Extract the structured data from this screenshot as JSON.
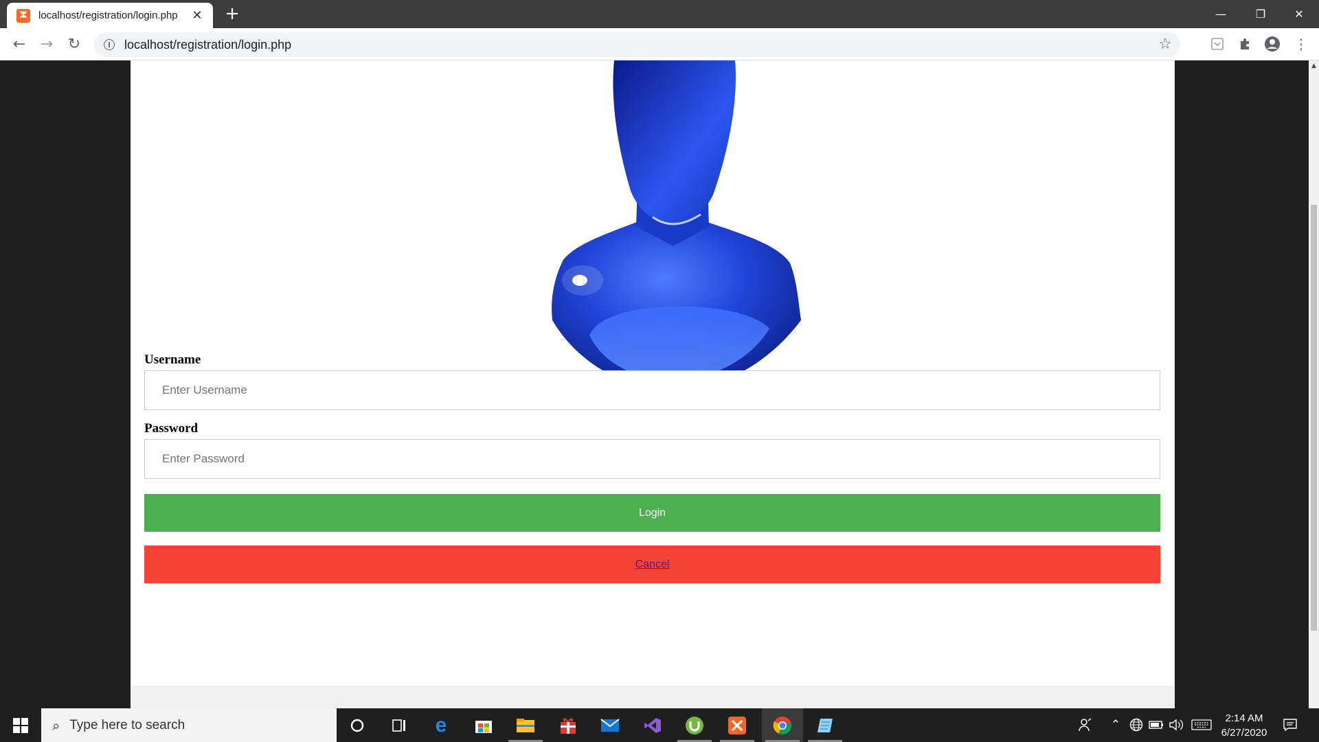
{
  "browser": {
    "tab_title": "localhost/registration/login.php",
    "tab_favicon": "xampp-icon",
    "new_tab_label": "+",
    "url": "localhost/registration/login.php"
  },
  "form": {
    "username_label": "Username",
    "username_placeholder": "Enter Username",
    "password_label": "Password",
    "password_placeholder": "Enter Password",
    "login_label": "Login",
    "cancel_label": "Cancel"
  },
  "colors": {
    "login_button": "#4caf50",
    "cancel_button": "#f44336",
    "avatar_blue": "#1e3ecf"
  },
  "taskbar": {
    "search_placeholder": "Type here to search",
    "apps": [
      "cortana-icon",
      "task-view-icon",
      "edge-icon",
      "store-icon",
      "file-explorer-icon",
      "gift-icon",
      "mail-icon",
      "visual-studio-icon",
      "utorrent-icon",
      "xampp-icon",
      "chrome-icon",
      "notepad-icon"
    ],
    "time": "2:14 AM",
    "date": "6/27/2020"
  }
}
